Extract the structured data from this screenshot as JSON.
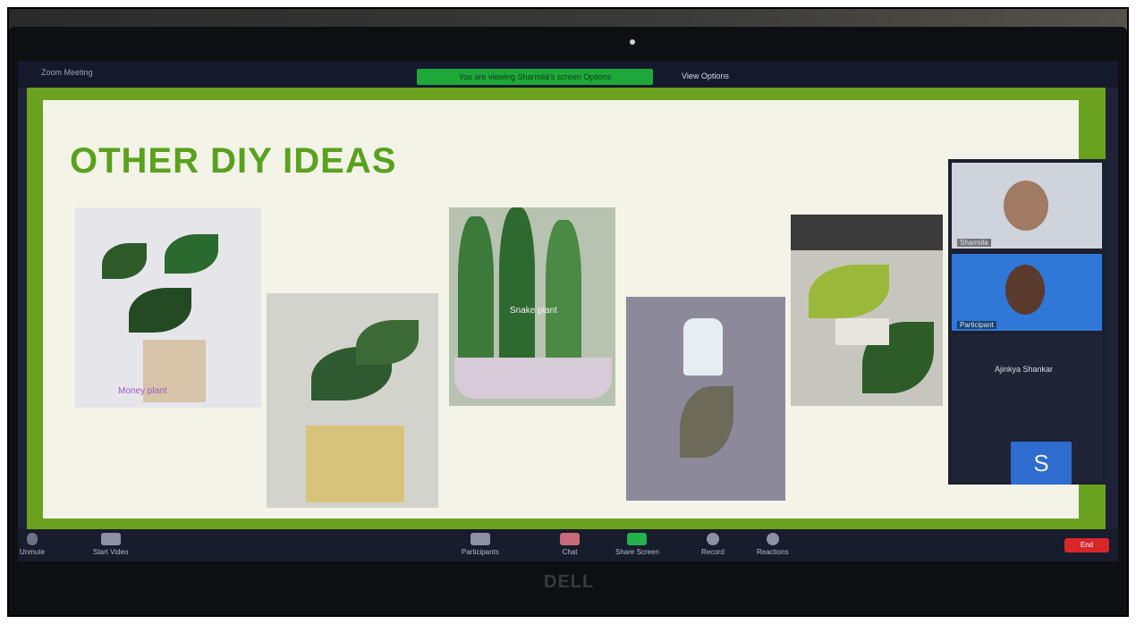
{
  "zoom": {
    "brand": "Zoom Meeting",
    "share_banner": "You are viewing Sharmila's screen  Options",
    "view_options": "View Options"
  },
  "slide": {
    "title": "OTHER DIY IDEAS",
    "captions": [
      "Money plant",
      "Snake plant"
    ]
  },
  "participants": [
    {
      "name": "Sharmila"
    },
    {
      "name": "Participant"
    },
    {
      "name": "Ajinkya Shankar",
      "initial": "S"
    }
  ],
  "toolbar": {
    "unmute": "Unmute",
    "stop_video": "Start Video",
    "participants": "Participants",
    "chat": "Chat",
    "share_screen": "Share Screen",
    "record": "Record",
    "reactions": "Reactions",
    "end": "End"
  },
  "laptop_brand": "DELL",
  "colors": {
    "slide_green": "#5aa21e",
    "zoom_bg": "#1d2236",
    "end_red": "#d8262b",
    "avatar_blue": "#2f6ccf"
  }
}
